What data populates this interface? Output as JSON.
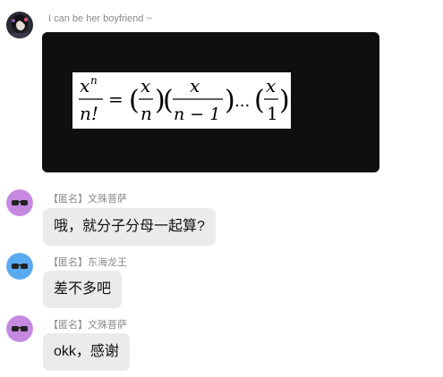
{
  "messages": [
    {
      "sender": "I can be her boyfriend ~",
      "avatar": "photo-avatar",
      "type": "image",
      "image": {
        "description_icon": "formula-image",
        "formula": {
          "lhs_num": "x",
          "lhs_num_sup": "n",
          "lhs_den": "n!",
          "equals": "=",
          "f1_num": "x",
          "f1_den": "n",
          "f2_num": "x",
          "f2_den": "n − 1",
          "dots": "...",
          "f3_num": "x",
          "f3_den": "1"
        }
      }
    },
    {
      "sender": "【匿名】文殊菩萨",
      "avatar": "sunglasses-avatar",
      "avatar_color": "#c58ae0",
      "text": "哦，就分子分母一起算?"
    },
    {
      "sender": "【匿名】东海龙王",
      "avatar": "sunglasses-avatar",
      "avatar_color": "#5aaaf0",
      "text": "差不多吧"
    },
    {
      "sender": "【匿名】文殊菩萨",
      "avatar": "sunglasses-avatar",
      "avatar_color": "#c58ae0",
      "text": "okk，感谢"
    }
  ]
}
